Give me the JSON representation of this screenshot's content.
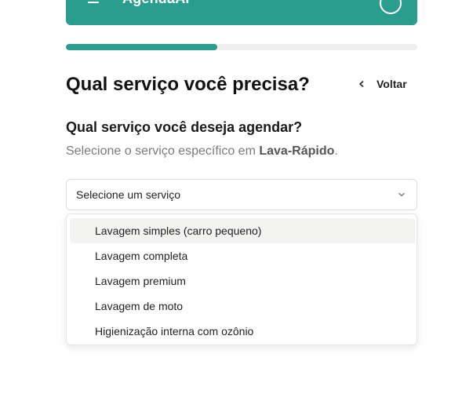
{
  "header": {
    "app_title": "AgendaAí"
  },
  "progress": {
    "fraction": 0.43
  },
  "page": {
    "title": "Qual serviço você precisa?",
    "back_label": "Voltar"
  },
  "question": {
    "title": "Qual serviço você deseja agendar?",
    "subtitle_prefix": "Selecione o serviço específico em ",
    "subtitle_bold": "Lava-Rápido",
    "subtitle_suffix": "."
  },
  "select": {
    "placeholder": "Selecione um serviço",
    "options": [
      "Lavagem simples (carro pequeno)",
      "Lavagem completa",
      "Lavagem premium",
      "Lavagem de moto",
      "Higienização interna com ozônio"
    ],
    "highlighted_index": 0
  },
  "icons": {
    "menu": "menu-icon",
    "header_chevron": "chevron-down-icon",
    "avatar": "avatar",
    "back": "chevron-left-icon",
    "select_chevron": "chevron-down-icon"
  },
  "colors": {
    "brand": "#2a9d8f"
  }
}
